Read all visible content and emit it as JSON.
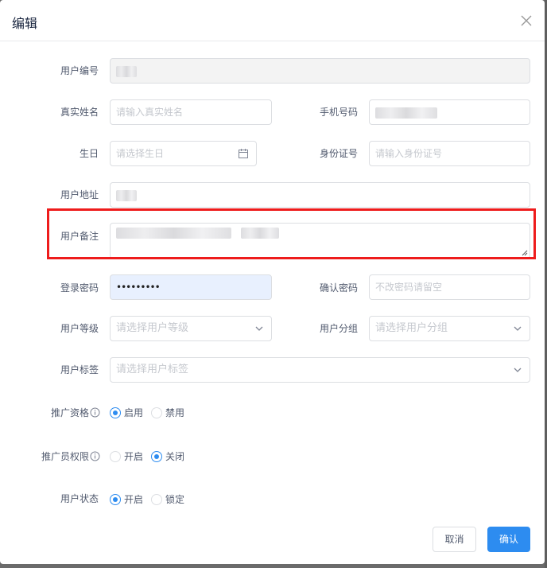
{
  "dialog": {
    "title": "编辑",
    "close_icon": "close-icon"
  },
  "fields": {
    "user_id": {
      "label": "用户编号"
    },
    "real_name": {
      "label": "真实姓名",
      "placeholder": "请输入真实姓名"
    },
    "phone": {
      "label": "手机号码"
    },
    "birthday": {
      "label": "生日",
      "placeholder": "请选择生日",
      "icon": "calendar-icon"
    },
    "id_card": {
      "label": "身份证号",
      "placeholder": "请输入身份证号"
    },
    "address": {
      "label": "用户地址"
    },
    "remark": {
      "label": "用户备注"
    },
    "password": {
      "label": "登录密码",
      "value": "•••••••••"
    },
    "confirm_password": {
      "label": "确认密码",
      "placeholder": "不改密码请留空"
    },
    "level": {
      "label": "用户等级",
      "placeholder": "请选择用户等级",
      "icon": "chevron-down-icon"
    },
    "group": {
      "label": "用户分组",
      "placeholder": "请选择用户分组",
      "icon": "chevron-down-icon"
    },
    "tags": {
      "label": "用户标签",
      "placeholder": "请选择用户标签",
      "icon": "chevron-down-icon"
    }
  },
  "radios": {
    "promotion_qualification": {
      "label": "推广资格",
      "options": [
        "启用",
        "禁用"
      ],
      "selected": "启用"
    },
    "promoter_permission": {
      "label": "推广员权限",
      "options": [
        "开启",
        "关闭"
      ],
      "selected": "关闭"
    },
    "user_status": {
      "label": "用户状态",
      "options": [
        "开启",
        "锁定"
      ],
      "selected": "开启"
    }
  },
  "buttons": {
    "cancel": "取消",
    "confirm": "确认"
  },
  "colors": {
    "primary": "#2d8cf0",
    "highlight_border": "#ee1c1c",
    "autofill_bg": "#e8f0fe"
  }
}
